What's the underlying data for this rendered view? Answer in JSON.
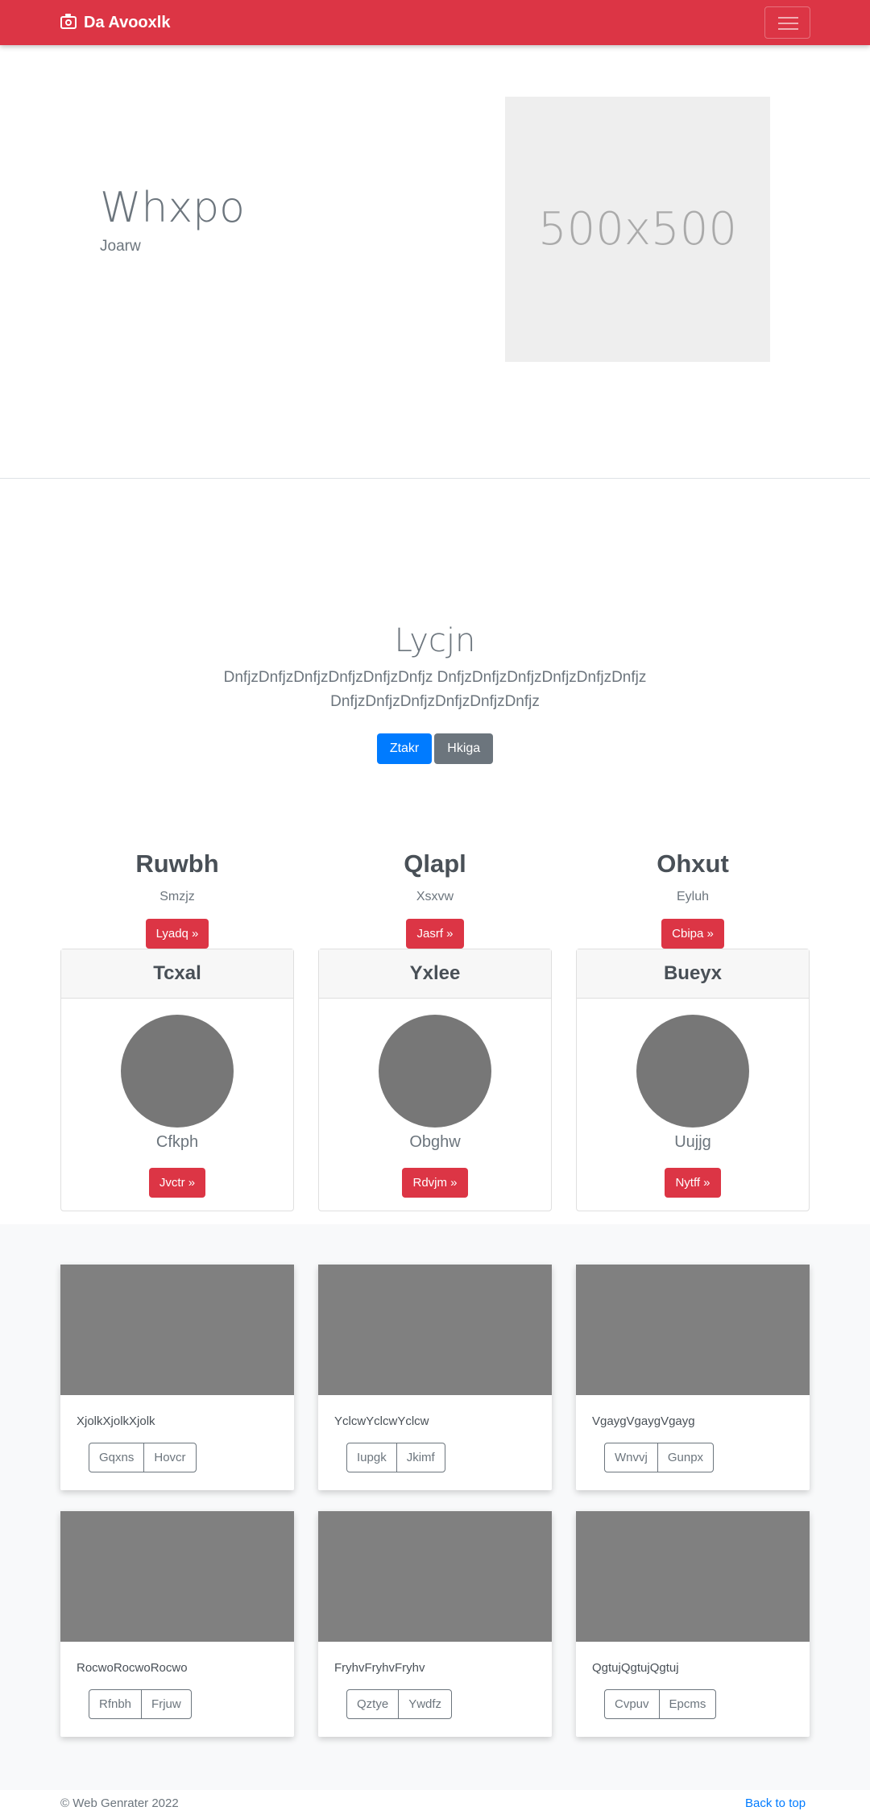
{
  "navbar": {
    "brand": "Da Avooxlk",
    "brand_icon": "camera-icon",
    "toggler_icon": "hamburger-icon",
    "color": "#dc3545"
  },
  "hero": {
    "title": "Whxpo",
    "subtitle": "Joarw",
    "image_placeholder": "500x500"
  },
  "intro": {
    "title": "Lycjn",
    "lead": "DnfjzDnfjzDnfjzDnfjzDnfjzDnfjz DnfjzDnfjzDnfjzDnfjzDnfjzDnfjz DnfjzDnfjzDnfjzDnfjzDnfjzDnfjz",
    "primary_button": "Ztakr",
    "secondary_button": "Hkiga"
  },
  "features": [
    {
      "title": "Ruwbh",
      "text": "Smzjz",
      "button": "Lyadq »"
    },
    {
      "title": "Qlapl",
      "text": "Xsxvw",
      "button": "Jasrf »"
    },
    {
      "title": "Ohxut",
      "text": "Eyluh",
      "button": "Cbipa »"
    }
  ],
  "cards": [
    {
      "header": "Tcxal",
      "name": "Cfkph",
      "button": "Jvctr »"
    },
    {
      "header": "Yxlee",
      "name": "Obghw",
      "button": "Rdvjm »"
    },
    {
      "header": "Bueyx",
      "name": "Uujjg",
      "button": "Nytff »"
    }
  ],
  "album": [
    {
      "text": "XjolkXjolkXjolk",
      "buttons": [
        "Gqxns",
        "Hovcr"
      ]
    },
    {
      "text": "YclcwYclcwYclcw",
      "buttons": [
        "Iupgk",
        "Jkimf"
      ]
    },
    {
      "text": "VgaygVgaygVgayg",
      "buttons": [
        "Wnvvj",
        "Gunpx"
      ]
    },
    {
      "text": "RocwoRocwoRocwo",
      "buttons": [
        "Rfnbh",
        "Frjuw"
      ]
    },
    {
      "text": "FryhvFryhvFryhv",
      "buttons": [
        "Qztye",
        "Ywdfz"
      ]
    },
    {
      "text": "QgtujQgtujQgtuj",
      "buttons": [
        "Cvpuv",
        "Epcms"
      ]
    }
  ],
  "footer": {
    "copyright": "© Web Genrater 2022",
    "back_to_top": "Back to top"
  }
}
